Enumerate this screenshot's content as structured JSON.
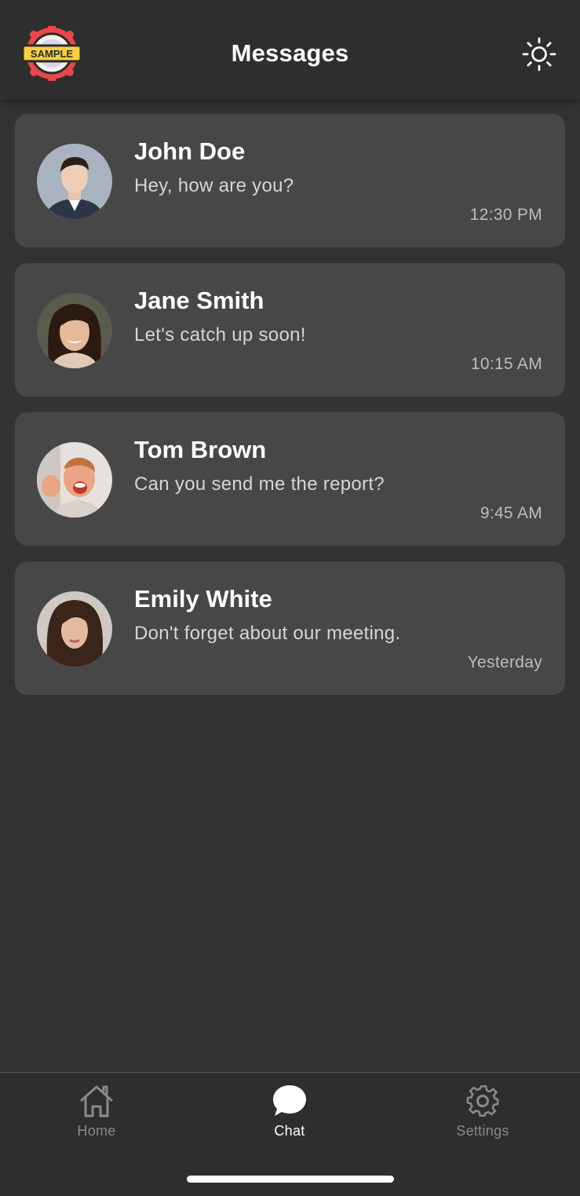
{
  "header": {
    "title": "Messages",
    "logo_text": "SAMPLE",
    "logo_icon": "sample-badge-logo",
    "theme_icon": "sun-icon"
  },
  "conversations": [
    {
      "name": "John Doe",
      "preview": "Hey, how are you?",
      "time": "12:30 PM",
      "avatar_icon": "avatar-photo"
    },
    {
      "name": "Jane Smith",
      "preview": "Let's catch up soon!",
      "time": "10:15 AM",
      "avatar_icon": "avatar-photo"
    },
    {
      "name": "Tom Brown",
      "preview": "Can you send me the report?",
      "time": "9:45 AM",
      "avatar_icon": "avatar-photo"
    },
    {
      "name": "Emily White",
      "preview": "Don't forget about our meeting.",
      "time": "Yesterday",
      "avatar_icon": "avatar-photo"
    }
  ],
  "nav": {
    "items": [
      {
        "label": "Home",
        "icon": "home-icon",
        "active": false
      },
      {
        "label": "Chat",
        "icon": "chat-bubble-icon",
        "active": true
      },
      {
        "label": "Settings",
        "icon": "gear-icon",
        "active": false
      }
    ]
  },
  "colors": {
    "background": "#333333",
    "header": "#2e2e2e",
    "card": "#474747",
    "text_primary": "#ffffff",
    "text_secondary": "#d6d6d6",
    "text_muted": "#8a8a8a",
    "logo_red": "#e8474c",
    "logo_yellow": "#f7d046"
  }
}
